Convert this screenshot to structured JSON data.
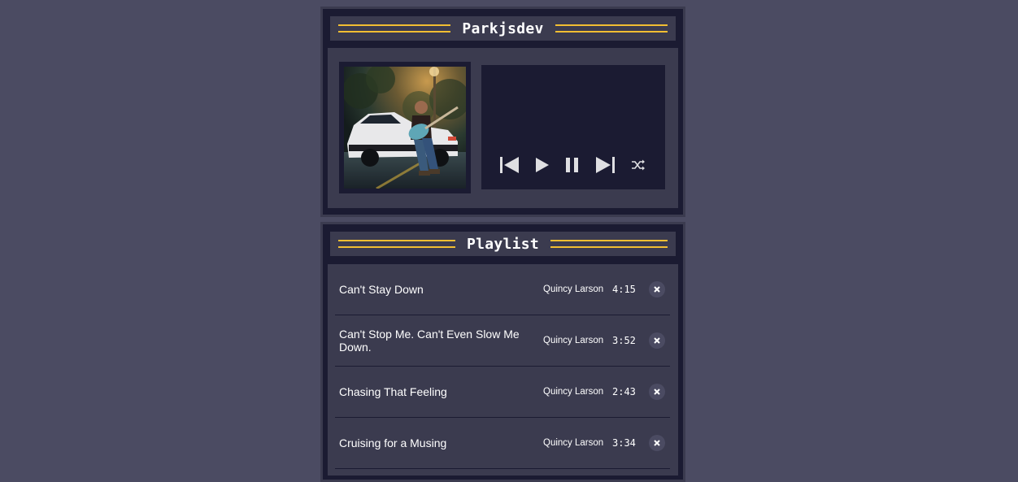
{
  "player": {
    "title": "Parkjsdev",
    "album_art_alt": "Album art: guitarist sitting on a white car at night",
    "controls": [
      {
        "name": "previous-button",
        "icon": "skip-previous-icon"
      },
      {
        "name": "play-button",
        "icon": "play-icon"
      },
      {
        "name": "pause-button",
        "icon": "pause-icon"
      },
      {
        "name": "next-button",
        "icon": "skip-next-icon"
      },
      {
        "name": "shuffle-button",
        "icon": "shuffle-icon"
      }
    ]
  },
  "playlist": {
    "title": "Playlist",
    "tracks": [
      {
        "title": "Can't Stay Down",
        "artist": "Quincy Larson",
        "duration": "4:15"
      },
      {
        "title": "Can't Stop Me. Can't Even Slow Me Down.",
        "artist": "Quincy Larson",
        "duration": "3:52"
      },
      {
        "title": "Chasing That Feeling",
        "artist": "Quincy Larson",
        "duration": "2:43"
      },
      {
        "title": "Cruising for a Musing",
        "artist": "Quincy Larson",
        "duration": "3:34"
      }
    ]
  },
  "colors": {
    "background": "#4b4b62",
    "panel": "#1b1b32",
    "panel_inner": "#3b3b4f",
    "accent": "#f1be32",
    "text": "#ffffff",
    "icon": "#dfdfe2"
  }
}
